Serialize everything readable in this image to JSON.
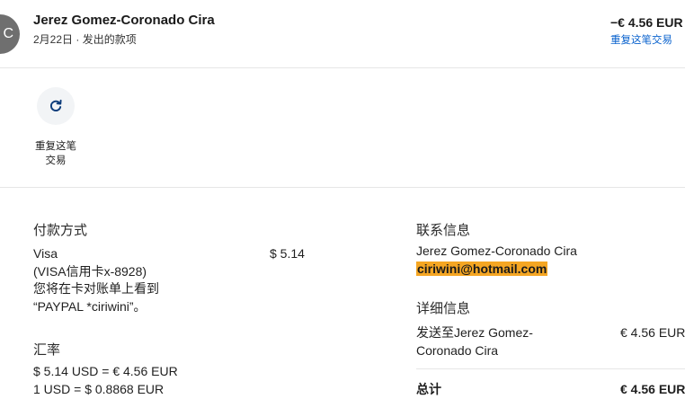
{
  "header": {
    "avatar_initials": "C",
    "name": "Jerez Gomez-Coronado Cira",
    "date": "2月22日",
    "separator": "·",
    "transaction_type": "发出的款项",
    "amount": "−€ 4.56 EUR",
    "repeat_link": "重复这笔交易"
  },
  "actions": {
    "repeat_label": "重复这笔交易",
    "repeat_icon": "refresh-icon"
  },
  "payment": {
    "title": "付款方式",
    "method": "Visa",
    "card": "(VISA信用卡x-8928)",
    "statement_line1": "您将在卡对账单上看到",
    "statement_line2": "“PAYPAL *ciriwini”。",
    "amount": "$ 5.14"
  },
  "exchange": {
    "title": "汇率",
    "line1": "$ 5.14 USD = € 4.56 EUR",
    "line2": "1 USD = $ 0.8868 EUR"
  },
  "contact": {
    "title": "联系信息",
    "name": "Jerez Gomez-Coronado Cira",
    "email": "ciriwini@hotmail.com"
  },
  "details": {
    "title": "详细信息",
    "sent_to_line1": "发送至Jerez Gomez-",
    "sent_to_line2": "Coronado Cira",
    "sent_amount": "€ 4.56 EUR",
    "total_label": "总计",
    "total_amount": "€ 4.56 EUR"
  },
  "colors": {
    "link": "#0b63ce",
    "email_highlight": "#f5a623",
    "avatar": "#6f6f6f"
  }
}
